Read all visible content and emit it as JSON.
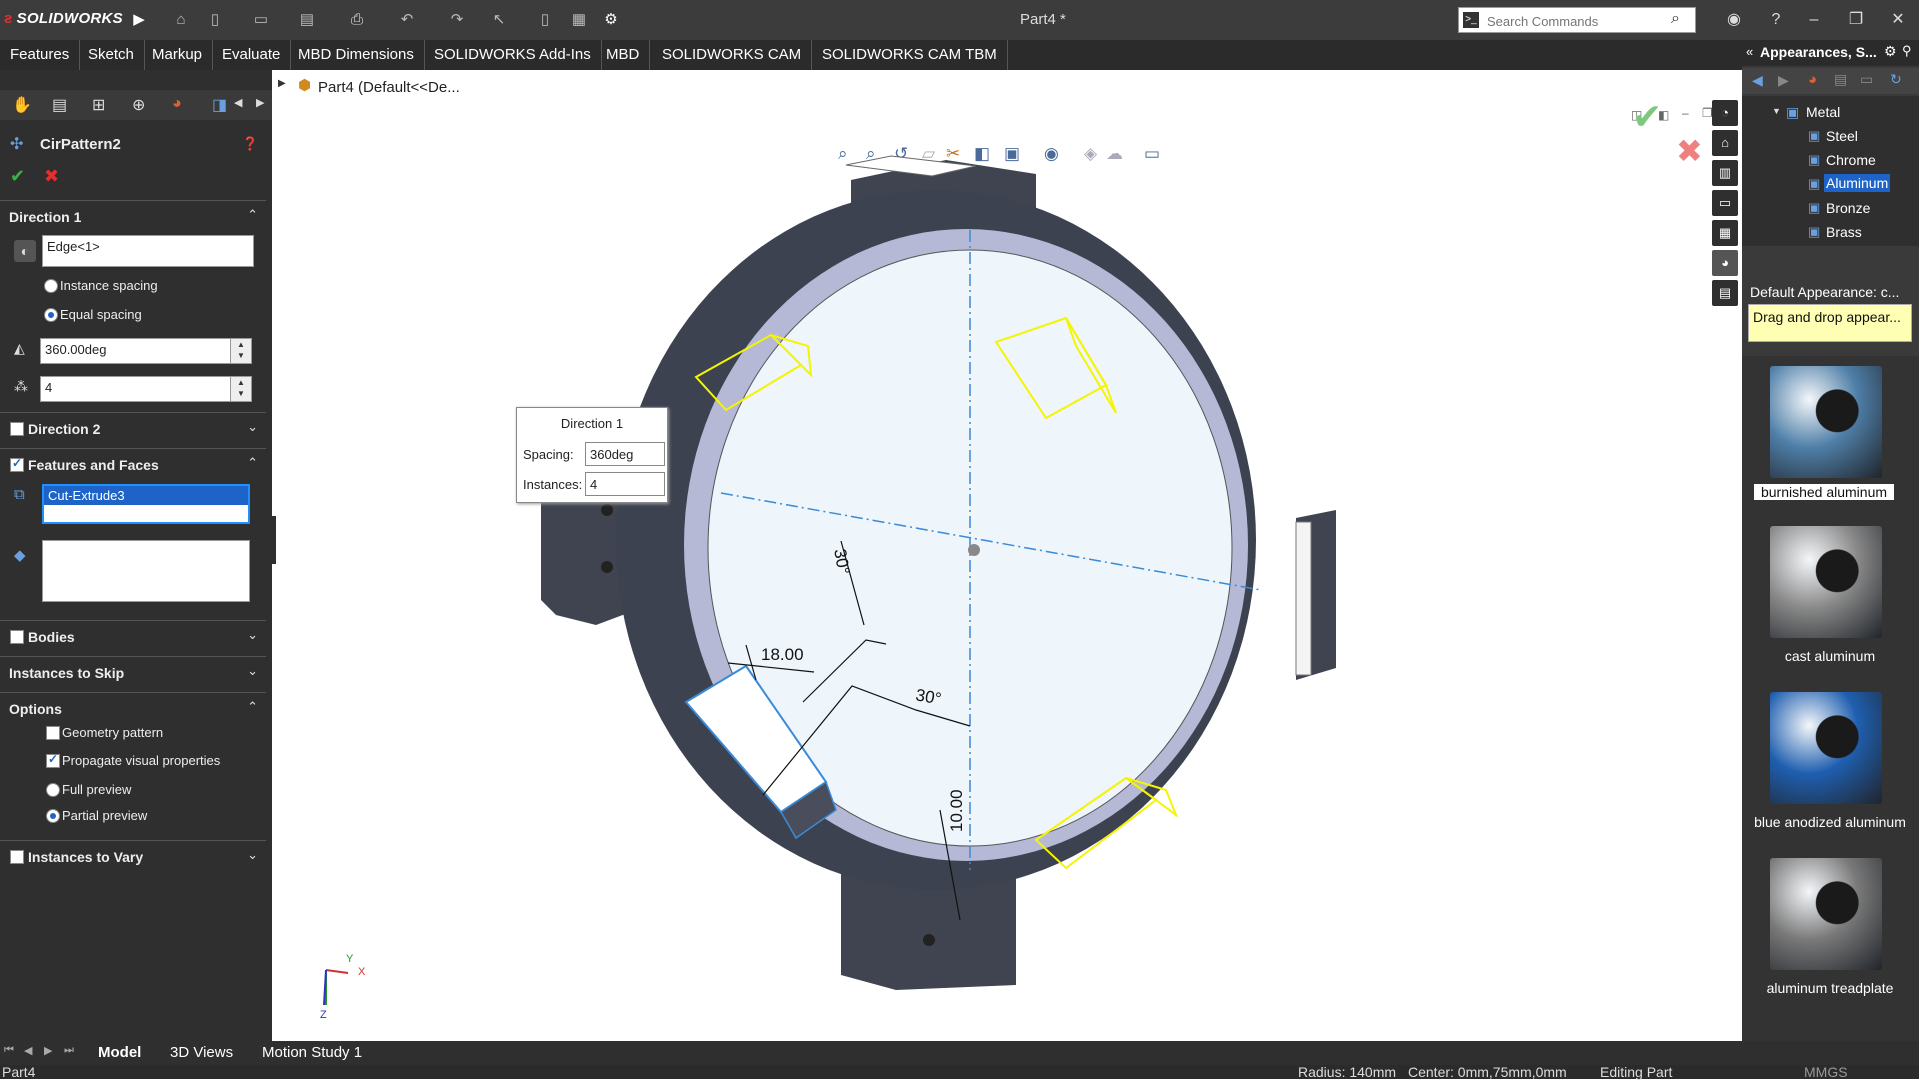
{
  "app": {
    "brand": "SOLIDWORKS",
    "doc_title": "Part4 *"
  },
  "search": {
    "placeholder": "Search Commands"
  },
  "command_tabs": [
    "Features",
    "Sketch",
    "Markup",
    "Evaluate",
    "MBD Dimensions",
    "SOLIDWORKS Add-Ins",
    "MBD",
    "SOLIDWORKS CAM",
    "SOLIDWORKS CAM TBM"
  ],
  "feature_tree_header": "Part4  (Default<<De...",
  "property_manager": {
    "title": "CirPattern2",
    "direction1": {
      "label": "Direction 1",
      "axis": "Edge<1>",
      "instance_spacing": "Instance spacing",
      "equal_spacing": "Equal spacing",
      "angle": "360.00deg",
      "count": "4"
    },
    "direction2": {
      "label": "Direction 2"
    },
    "features_faces": {
      "label": "Features and Faces",
      "selected": "Cut-Extrude3"
    },
    "bodies": {
      "label": "Bodies"
    },
    "instances_skip": {
      "label": "Instances to Skip"
    },
    "options": {
      "label": "Options",
      "geometry_pattern": "Geometry pattern",
      "propagate": "Propagate visual properties",
      "full_preview": "Full preview",
      "partial_preview": "Partial preview"
    },
    "instances_vary": {
      "label": "Instances to Vary"
    }
  },
  "callout": {
    "title": "Direction 1",
    "spacing_label": "Spacing:",
    "spacing_value": "360deg",
    "instances_label": "Instances:",
    "instances_value": "4"
  },
  "dimensions": {
    "angle_top": "30°",
    "width": "18.00",
    "angle_bottom": "30°",
    "depth": "10.00"
  },
  "triad": {
    "x": "X",
    "y": "Y",
    "z": "Z"
  },
  "appearances": {
    "title": "Appearances, S...",
    "tree": {
      "parent": "Metal",
      "children": [
        "Steel",
        "Chrome",
        "Aluminum",
        "Bronze",
        "Brass"
      ],
      "selected": "Aluminum"
    },
    "default_label": "Default Appearance: c...",
    "tooltip": "Drag and drop appear...",
    "swatches": [
      {
        "name": "burnished aluminum",
        "color": "#4f7fa8"
      },
      {
        "name": "cast aluminum",
        "color": "#8a8a8a"
      },
      {
        "name": "blue anodized aluminum",
        "color": "#1f5fb0"
      },
      {
        "name": "aluminum treadplate",
        "color": "#7a7a7a"
      }
    ]
  },
  "bottom_tabs": [
    "Model",
    "3D Views",
    "Motion Study 1"
  ],
  "status": {
    "part": "Part4",
    "radius": "Radius: 140mm",
    "center": "Center: 0mm,75mm,0mm",
    "mode": "Editing Part",
    "units": "MMGS"
  },
  "colors": {
    "accent": "#1e64c8",
    "dark_bg": "#2f2f2f",
    "highlight_yellow": "#f5f500"
  }
}
